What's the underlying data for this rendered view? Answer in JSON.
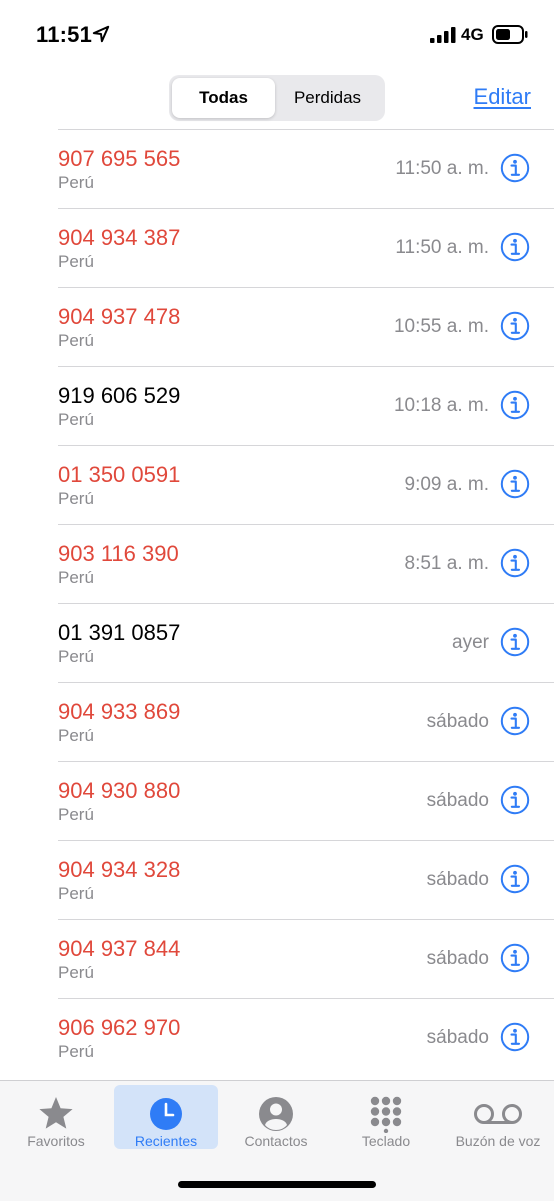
{
  "status_bar": {
    "time": "11:51",
    "network": "4G",
    "icons": [
      "location-arrow-icon",
      "signal-icon",
      "battery-icon"
    ]
  },
  "header": {
    "segments": [
      "Todas",
      "Perdidas"
    ],
    "selected_segment": "Todas",
    "edit_label": "Editar"
  },
  "colors": {
    "accent": "#2f7cf6",
    "missed": "#e0483b",
    "secondary_text": "#8a8a8e"
  },
  "calls": [
    {
      "number": "907 695 565",
      "country": "Perú",
      "time": "11:50 a. m.",
      "missed": true
    },
    {
      "number": "904 934 387",
      "country": "Perú",
      "time": "11:50 a. m.",
      "missed": true
    },
    {
      "number": "904 937 478",
      "country": "Perú",
      "time": "10:55 a. m.",
      "missed": true
    },
    {
      "number": "919 606 529",
      "country": "Perú",
      "time": "10:18 a. m.",
      "missed": false
    },
    {
      "number": "01 350 0591",
      "country": "Perú",
      "time": "9:09 a. m.",
      "missed": true
    },
    {
      "number": "903 116 390",
      "country": "Perú",
      "time": "8:51 a. m.",
      "missed": true
    },
    {
      "number": "01 391 0857",
      "country": "Perú",
      "time": "ayer",
      "missed": false
    },
    {
      "number": "904 933 869",
      "country": "Perú",
      "time": "sábado",
      "missed": true
    },
    {
      "number": "904 930 880",
      "country": "Perú",
      "time": "sábado",
      "missed": true
    },
    {
      "number": "904 934 328",
      "country": "Perú",
      "time": "sábado",
      "missed": true
    },
    {
      "number": "904 937 844",
      "country": "Perú",
      "time": "sábado",
      "missed": true
    },
    {
      "number": "906 962 970",
      "country": "Perú",
      "time": "sábado",
      "missed": true
    }
  ],
  "tab_bar": {
    "tabs": [
      {
        "label": "Favoritos",
        "icon": "star-icon"
      },
      {
        "label": "Recientes",
        "icon": "clock-icon"
      },
      {
        "label": "Contactos",
        "icon": "contact-icon"
      },
      {
        "label": "Teclado",
        "icon": "keypad-icon"
      },
      {
        "label": "Buzón de voz",
        "icon": "voicemail-icon"
      }
    ],
    "active": "Recientes"
  }
}
